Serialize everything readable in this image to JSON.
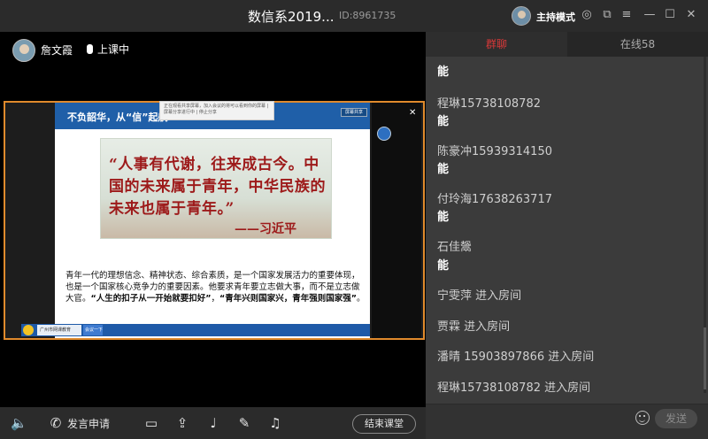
{
  "titlebar": {
    "title": "数信系2019...",
    "room_id": "ID:8961735",
    "host_mode": "主持模式",
    "icons": [
      "settings-icon",
      "popout-icon",
      "menu-icon",
      "minimize-icon",
      "maximize-icon",
      "close-icon"
    ]
  },
  "teacher": {
    "name": "詹文霞",
    "status": "上课中"
  },
  "shared_screen": {
    "header_title": "不负韶华，从“信”起航",
    "toolbar_text": "正在观看共享屏幕，加入会议的将可以看到你的屏幕 | 屏幕分享进行中 | 停止分享",
    "mini_button": "屏幕共享",
    "quote": "“人事有代谢，往来成古今。中国的未来属于青年，中华民族的未来也属于青年。”",
    "quote_author": "——习近平",
    "body_line1": "青年一代的理想信念、精神状态、综合素质，是一个国家发展活力的重要体现，也是一个国家核心竞争力的重要因素。他要求青年要立志做大事，而不是立志做大官。",
    "body_em1": "“人生的扣子从一开始就要扣好”",
    "body_mid": "，",
    "body_em2": "“青年兴则国家兴，青年强则国家强”",
    "body_end": "。",
    "taskbar_item1": "广州市网课教育",
    "taskbar_item2": "会议一下"
  },
  "bottombar": {
    "speak_request": "发言申请",
    "end_class": "结束课堂"
  },
  "chat": {
    "tab_chat": "群聊",
    "tab_online": "在线58",
    "messages": [
      {
        "sender": "",
        "text": "能"
      },
      {
        "sender": "程琳15738108782",
        "text": "能"
      },
      {
        "sender": "陈豪冲15939314150",
        "text": "能"
      },
      {
        "sender": "付玲海17638263717",
        "text": "能"
      },
      {
        "sender": "石佳鬶",
        "text": "能"
      }
    ],
    "events": [
      "宁雯萍 进入房间",
      "贾霖 进入房间",
      "潘晴 15903897866 进入房间",
      "程琳15738108782 进入房间"
    ],
    "send_label": "发送"
  }
}
